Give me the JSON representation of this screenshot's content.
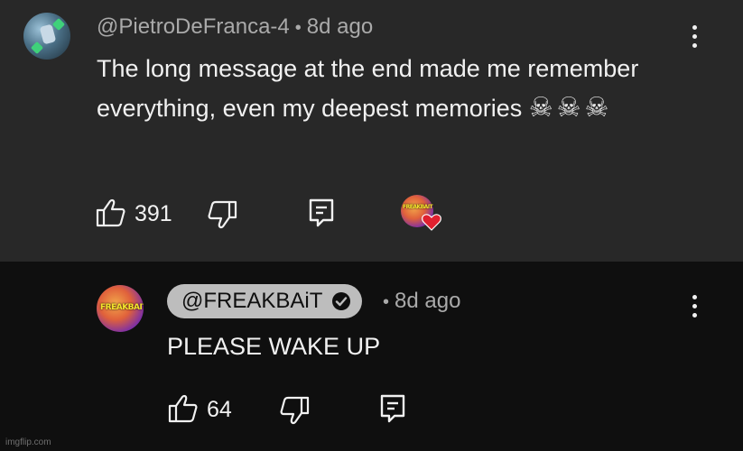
{
  "comments": [
    {
      "author": "@PietroDeFranca-4",
      "separator": "•",
      "time": "8d ago",
      "text": "The long message at the end made me remember everything, even my deepest memories",
      "emoji": "☠☠☠",
      "likes": "391",
      "icons": {
        "like": "thumbs-up-icon",
        "dislike": "thumbs-down-icon",
        "reply": "reply-icon",
        "menu": "more-vert-icon",
        "creator_heart": "heart-icon"
      }
    },
    {
      "author": "@FREAKBAiT",
      "verified": true,
      "separator": "•",
      "time": "8d ago",
      "text": "PLEASE WAKE UP",
      "likes": "64",
      "avatar_text": "FREAKBAIT",
      "icons": {
        "like": "thumbs-up-icon",
        "dislike": "thumbs-down-icon",
        "reply": "reply-icon",
        "menu": "more-vert-icon",
        "verified": "checkmark-circle-icon"
      }
    }
  ],
  "creator_heart_avatar_text": "FREAKBAIT",
  "watermark": "imgflip.com",
  "colors": {
    "top_bg": "#282828",
    "bottom_bg": "#0f0f0f",
    "meta_text": "#aaaaaa",
    "heart": "#e0202f",
    "chip_bg": "#bdbdbd"
  }
}
